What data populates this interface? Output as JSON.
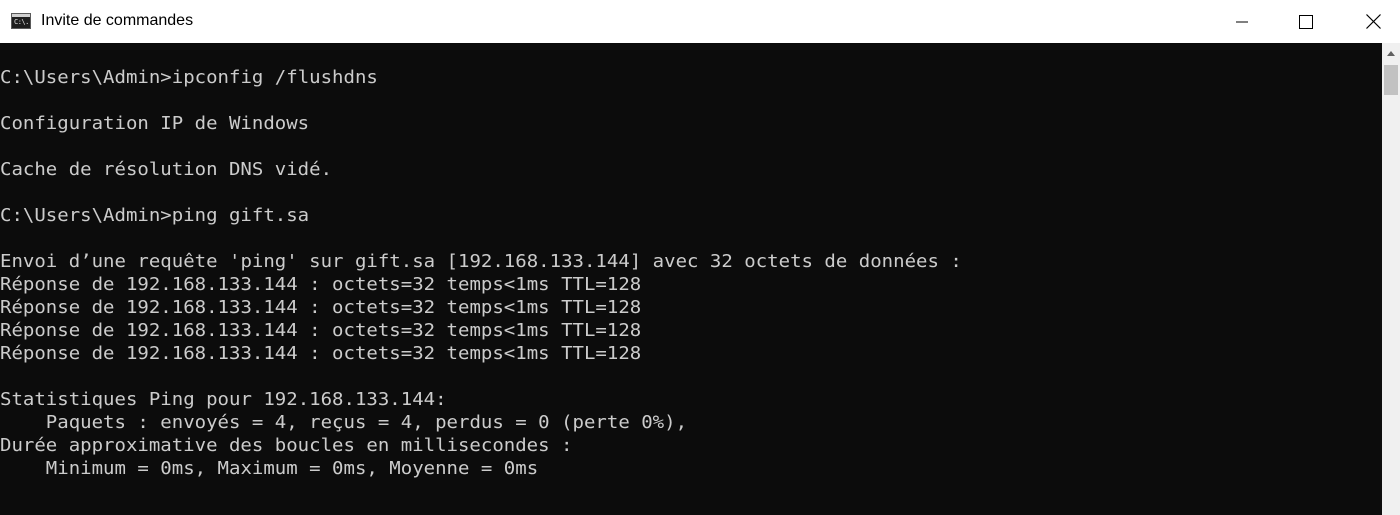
{
  "window": {
    "title": "Invite de commandes",
    "icon": "console-app-icon",
    "icon_text": "C:\\."
  },
  "controls": {
    "minimize": "minimize-icon",
    "maximize": "maximize-icon",
    "close": "close-icon"
  },
  "console": {
    "lines": [
      "C:\\Users\\Admin>ipconfig /flushdns",
      "Configuration IP de Windows",
      "Cache de résolution DNS vidé.",
      "C:\\Users\\Admin>ping gift.sa",
      "Envoi d’une requête 'ping' sur gift.sa [192.168.133.144] avec 32 octets de données :",
      "Réponse de 192.168.133.144 : octets=32 temps<1ms TTL=128",
      "Réponse de 192.168.133.144 : octets=32 temps<1ms TTL=128",
      "Réponse de 192.168.133.144 : octets=32 temps<1ms TTL=128",
      "Réponse de 192.168.133.144 : octets=32 temps<1ms TTL=128",
      "Statistiques Ping pour 192.168.133.144:",
      "    Paquets : envoyés = 4, reçus = 4, perdus = 0 (perte 0%),",
      "Durée approximative des boucles en millisecondes :",
      "    Minimum = 0ms, Maximum = 0ms, Moyenne = 0ms"
    ]
  },
  "colors": {
    "console_bg": "#0c0c0c",
    "console_text": "#cccccc",
    "titlebar_bg": "#ffffff"
  }
}
